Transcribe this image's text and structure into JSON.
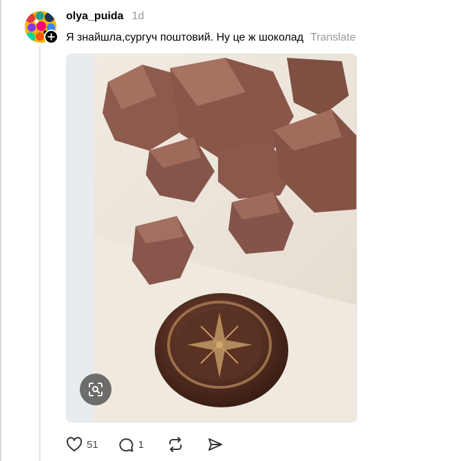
{
  "post": {
    "username": "olya_puida",
    "timestamp": "1d",
    "text": "Я знайшла,сургуч поштовий. Ну це ж шоколад",
    "translate_label": "Translate"
  },
  "actions": {
    "like_count": "51",
    "reply_count": "1"
  },
  "icons": {
    "follow": "plus-icon",
    "lens": "visual-search-icon",
    "like": "heart-icon",
    "reply": "speech-bubble-icon",
    "repost": "repost-icon",
    "share": "send-icon"
  },
  "colors": {
    "text": "#000000",
    "muted": "#999999",
    "thread_line": "#e0e0e0"
  }
}
